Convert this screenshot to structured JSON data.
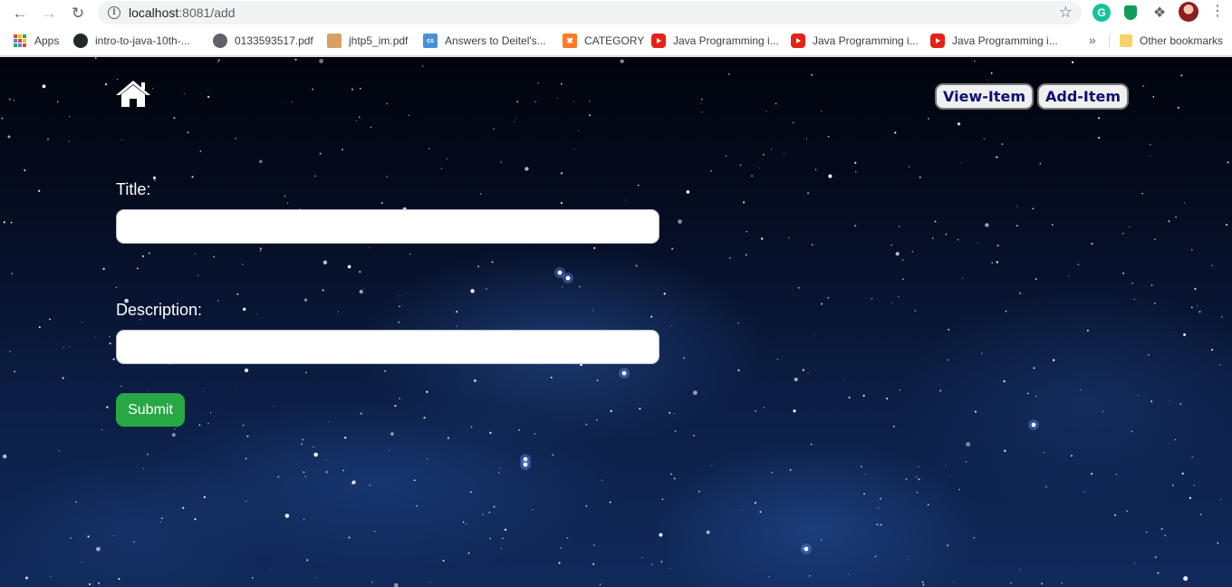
{
  "browser": {
    "url_host": "localhost",
    "url_path": ":8081/add",
    "bookmarks": [
      {
        "label": "Apps",
        "icon": "apps-grid-icon"
      },
      {
        "label": "intro-to-java-10th-...",
        "icon": "github-icon"
      },
      {
        "label": "0133593517.pdf",
        "icon": "globe-icon"
      },
      {
        "label": "jhtp5_im.pdf",
        "icon": "person-icon"
      },
      {
        "label": "Answers to Deitel's...",
        "icon": "cs-icon"
      },
      {
        "label": "CATEGORY",
        "icon": "xampp-icon"
      },
      {
        "label": "Java Programming i...",
        "icon": "youtube-icon"
      },
      {
        "label": "Java Programming i...",
        "icon": "youtube-icon"
      },
      {
        "label": "Java Programming i...",
        "icon": "youtube-icon"
      }
    ],
    "other_bookmarks": "Other bookmarks",
    "more_bookmarks": "»"
  },
  "nav": {
    "view_item": "View-Item",
    "add_item": "Add-Item"
  },
  "form": {
    "title_label": "Title:",
    "title_value": "",
    "description_label": "Description:",
    "description_value": "",
    "submit_label": "Submit"
  },
  "colors": {
    "submit": "#28a745",
    "nav_text": "#101070",
    "background_top": "#01040c",
    "background_bottom": "#112a5c"
  }
}
